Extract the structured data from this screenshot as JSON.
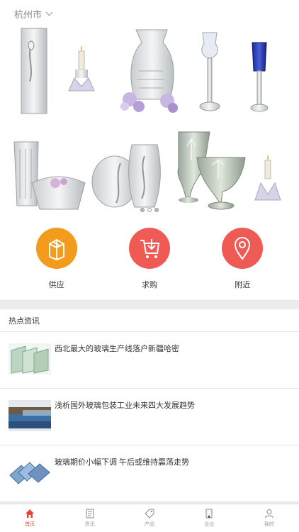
{
  "location": {
    "city": "杭州市"
  },
  "banner": {
    "slide_count": 3,
    "active_slide": 1
  },
  "categories": [
    {
      "label": "供应",
      "icon": "box-icon",
      "color": "#f39b1d"
    },
    {
      "label": "求购",
      "icon": "cart-download-icon",
      "color": "#f05a55"
    },
    {
      "label": "附近",
      "icon": "map-pin-icon",
      "color": "#f05a55"
    }
  ],
  "news": {
    "heading": "热点资讯",
    "items": [
      {
        "title": "西北最大的玻璃生产线落户新疆哈密",
        "thumb": "glass-panes-green"
      },
      {
        "title": "浅析国外玻璃包装工业未来四大发展趋势",
        "thumb": "glass-panels-blue"
      },
      {
        "title": "玻璃期价小幅下调 午后或维持震荡走势",
        "thumb": "glass-sheets-blue"
      }
    ]
  },
  "tabbar": {
    "active": 0,
    "tabs": [
      {
        "label": "首页",
        "icon": "home-icon"
      },
      {
        "label": "资讯",
        "icon": "news-icon"
      },
      {
        "label": "产品",
        "icon": "tag-icon"
      },
      {
        "label": "企业",
        "icon": "building-icon"
      },
      {
        "label": "我的",
        "icon": "user-icon"
      }
    ]
  },
  "colors": {
    "accent": "#e8453c",
    "supply": "#f39b1d",
    "demand": "#f05a55"
  }
}
